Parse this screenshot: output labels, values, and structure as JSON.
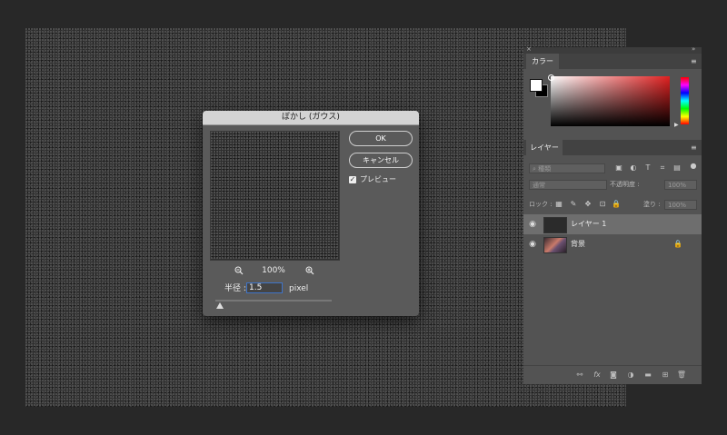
{
  "dialog": {
    "title": "ぼかし (ガウス)",
    "ok_label": "OK",
    "cancel_label": "キャンセル",
    "preview_label": "プレビュー",
    "preview_checked": true,
    "zoom_level": "100%",
    "radius_label": "半径 :",
    "radius_value": "1.5",
    "radius_unit": "pixel",
    "slider_level_fraction": 0.04
  },
  "color_panel": {
    "tab_label": "カラー",
    "foreground_color": "#ffffff",
    "background_color": "#000000",
    "field_hue_color": "#e02020"
  },
  "layers_panel": {
    "tab_label": "レイヤー",
    "filter_placeholder": "種類",
    "blend_mode": "通常",
    "opacity_label": "不透明度 :",
    "opacity_value": "100%",
    "lock_label": "ロック :",
    "fill_label": "塗り :",
    "fill_value": "100%",
    "layers": [
      {
        "name": "レイヤー 1",
        "selected": true,
        "locked": false
      },
      {
        "name": "背景",
        "selected": false,
        "locked": true
      }
    ]
  },
  "icons": {
    "zoom_out": "−",
    "zoom_in": "+",
    "eye": "◉",
    "lock": "🔒",
    "check": "✓",
    "menu": "≡",
    "close": "×",
    "collapse": "»"
  },
  "colors": {
    "accent_focus": "#3f74c8",
    "panel_bg": "#535353",
    "selected_layer": "#6e6e6e"
  }
}
